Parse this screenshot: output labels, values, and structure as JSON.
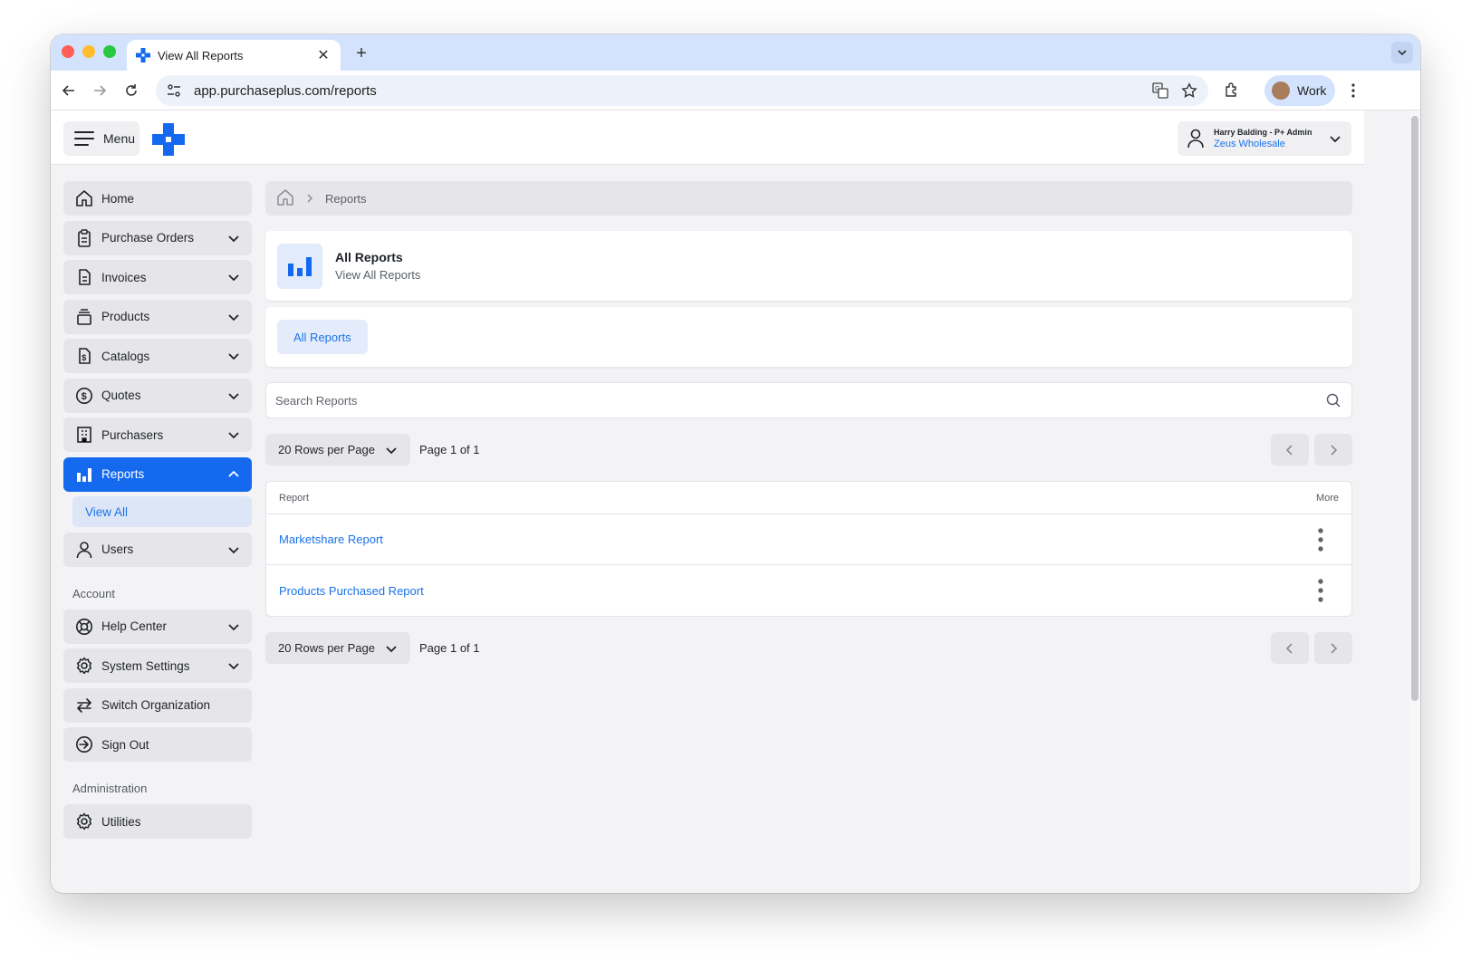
{
  "browser": {
    "tab_title": "View All Reports",
    "url": "app.purchaseplus.com/reports",
    "profile_label": "Work"
  },
  "header": {
    "menu_label": "Menu",
    "user_name": "Harry Balding - P+ Admin",
    "user_org": "Zeus Wholesale"
  },
  "sidebar": {
    "items": [
      {
        "label": "Home",
        "icon": "home-icon"
      },
      {
        "label": "Purchase Orders",
        "icon": "clipboard-icon"
      },
      {
        "label": "Invoices",
        "icon": "document-icon"
      },
      {
        "label": "Products",
        "icon": "box-icon"
      },
      {
        "label": "Catalogs",
        "icon": "catalog-icon"
      },
      {
        "label": "Quotes",
        "icon": "dollar-icon"
      },
      {
        "label": "Purchasers",
        "icon": "building-icon"
      },
      {
        "label": "Reports",
        "icon": "chart-icon"
      },
      {
        "label": "Users",
        "icon": "user-icon"
      }
    ],
    "reports_sub": "View All",
    "account_heading": "Account",
    "account_items": [
      {
        "label": "Help Center",
        "icon": "lifebuoy-icon"
      },
      {
        "label": "System Settings",
        "icon": "gear-icon"
      },
      {
        "label": "Switch Organization",
        "icon": "switch-icon"
      },
      {
        "label": "Sign Out",
        "icon": "sign-out-icon"
      }
    ],
    "admin_heading": "Administration",
    "admin_items": [
      {
        "label": "Utilities",
        "icon": "gear-icon"
      }
    ]
  },
  "main": {
    "breadcrumb": "Reports",
    "title": "All Reports",
    "subtitle": "View All Reports",
    "tab": "All Reports",
    "search_placeholder": "Search Reports",
    "rows_per_page": "20 Rows per Page",
    "page_info": "Page 1 of 1",
    "table": {
      "headers": [
        "Report",
        "More"
      ],
      "rows": [
        "Marketshare Report",
        "Products Purchased Report"
      ]
    }
  },
  "colors": {
    "accent": "#1469ef",
    "link": "#1a73e8",
    "tab_strip": "#d3e3fd"
  }
}
